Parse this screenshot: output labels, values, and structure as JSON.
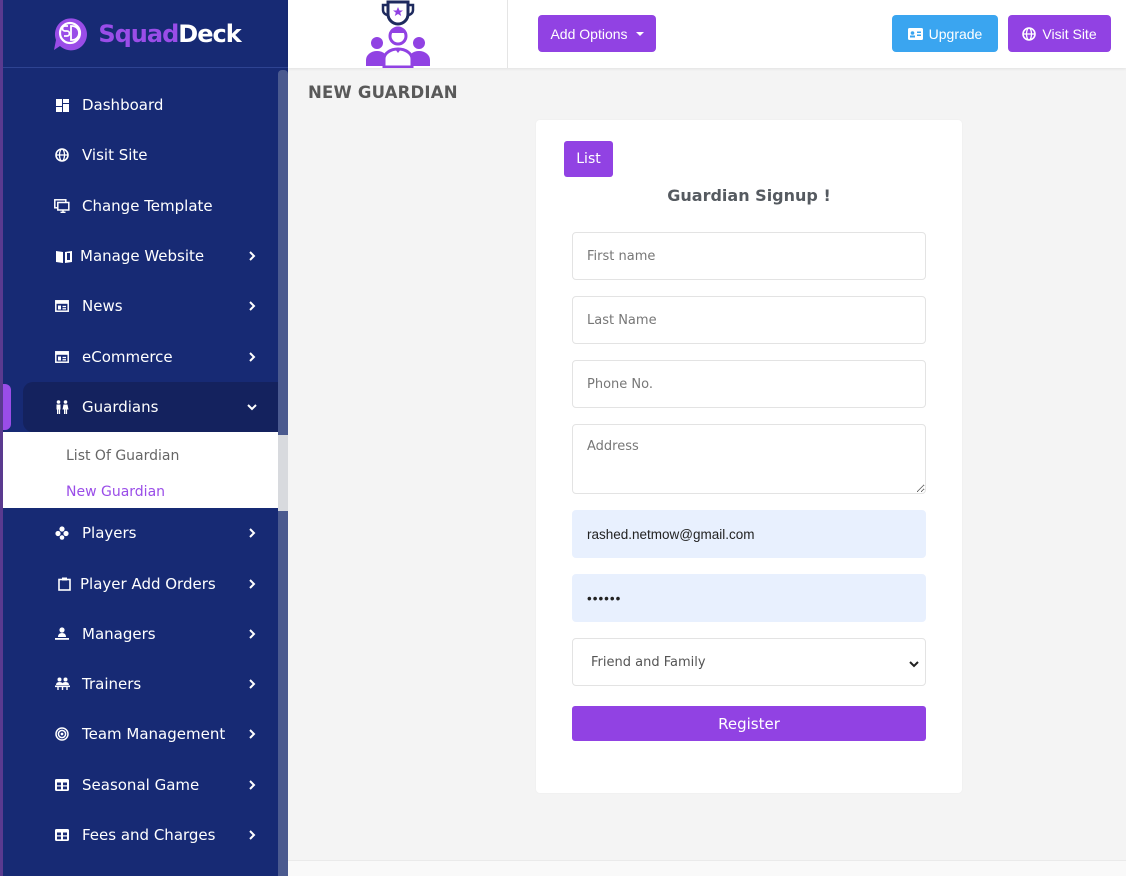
{
  "brand": {
    "name_part1": "Squad",
    "name_part2": "Deck",
    "accent": "#9142e3",
    "sidebar_bg": "#172a74"
  },
  "header": {
    "add_options_label": "Add Options",
    "upgrade_label": "Upgrade",
    "visit_site_label": "Visit Site"
  },
  "sidebar": {
    "items": [
      {
        "label": "Dashboard",
        "icon": "dashboard-icon",
        "has_children": false
      },
      {
        "label": "Visit Site",
        "icon": "globe-icon",
        "has_children": false
      },
      {
        "label": "Change Template",
        "icon": "monitor-icon",
        "has_children": false
      },
      {
        "label": "Manage Website",
        "icon": "book-icon",
        "has_children": true
      },
      {
        "label": "News",
        "icon": "newspaper-icon",
        "has_children": true
      },
      {
        "label": "eCommerce",
        "icon": "newspaper-icon",
        "has_children": true
      },
      {
        "label": "Guardians",
        "icon": "restroom-icon",
        "has_children": true,
        "expanded": true
      },
      {
        "label": "Players",
        "icon": "puzzle-icon",
        "has_children": true
      },
      {
        "label": "Player Add Orders",
        "icon": "clipboard-icon",
        "has_children": true
      },
      {
        "label": "Managers",
        "icon": "manager-icon",
        "has_children": true
      },
      {
        "label": "Trainers",
        "icon": "group-icon",
        "has_children": true
      },
      {
        "label": "Team Management",
        "icon": "target-icon",
        "has_children": true
      },
      {
        "label": "Seasonal Game",
        "icon": "table-icon",
        "has_children": true
      },
      {
        "label": "Fees and Charges",
        "icon": "table-icon",
        "has_children": true
      }
    ],
    "guardians_submenu": [
      {
        "label": "List Of Guardian",
        "current": false
      },
      {
        "label": "New Guardian",
        "current": true
      }
    ]
  },
  "page": {
    "title": "NEW GUARDIAN",
    "list_button": "List",
    "form_title": "Guardian Signup !",
    "fields": {
      "first_name": {
        "placeholder": "First name",
        "value": ""
      },
      "last_name": {
        "placeholder": "Last Name",
        "value": ""
      },
      "phone": {
        "placeholder": "Phone No.",
        "value": ""
      },
      "address": {
        "placeholder": "Address",
        "value": ""
      },
      "email": {
        "placeholder": "",
        "value": "rashed.netmow@gmail.com"
      },
      "password": {
        "placeholder": "",
        "value": "••••••"
      },
      "relation": {
        "selected": "Friend and Family"
      }
    },
    "register_label": "Register"
  }
}
